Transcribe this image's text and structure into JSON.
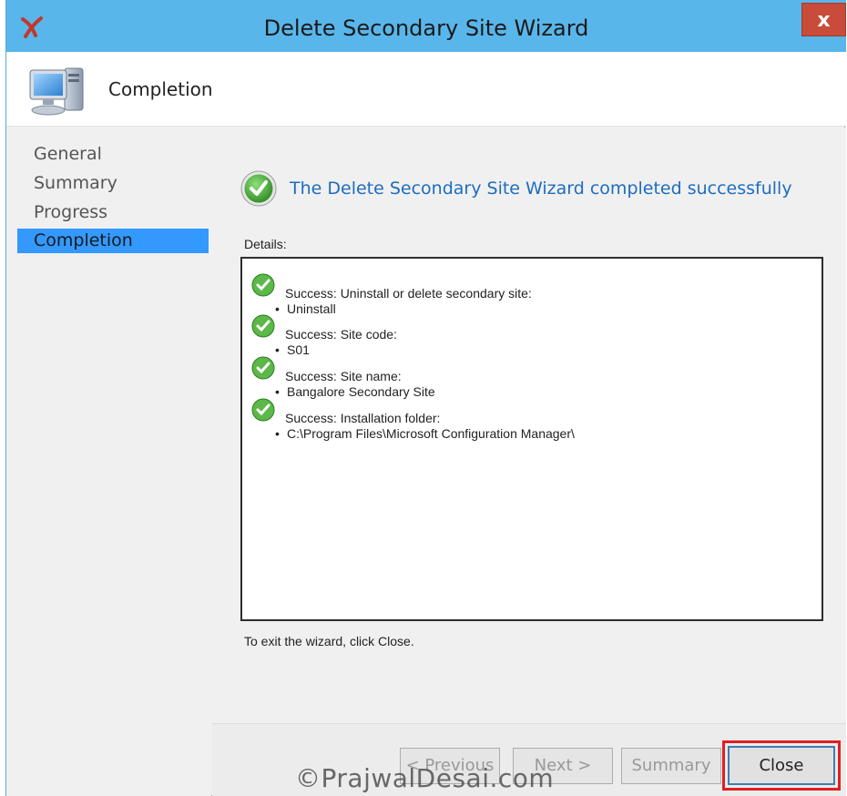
{
  "window": {
    "title": "Delete Secondary Site Wizard",
    "close_glyph": "x",
    "app_icon": "configmgr-icon",
    "accent_color": "#59b6ea"
  },
  "header": {
    "title": "Completion",
    "icon": "computer-icon"
  },
  "nav": {
    "items": [
      {
        "label": "General"
      },
      {
        "label": "Summary"
      },
      {
        "label": "Progress"
      },
      {
        "label": "Completion"
      }
    ],
    "active_index": 3,
    "active_color": "#3399ff"
  },
  "main": {
    "headline": "The Delete Secondary Site Wizard completed successfully",
    "headline_color": "#1c6dbf",
    "details_label": "Details:",
    "details": [
      {
        "title": "Success: Uninstall or delete secondary site:",
        "value": "Uninstall"
      },
      {
        "title": "Success: Site code:",
        "value": "S01"
      },
      {
        "title": "Success: Site name:",
        "value": "Bangalore Secondary Site"
      },
      {
        "title": "Success: Installation folder:",
        "value": "C:\\Program Files\\Microsoft Configuration Manager\\"
      }
    ],
    "exit_text": "To exit the wizard, click Close."
  },
  "buttons": {
    "previous": "< Previous",
    "next": "Next >",
    "summary": "Summary",
    "close": "Close"
  },
  "watermark": "©PrajwalDesai.com"
}
